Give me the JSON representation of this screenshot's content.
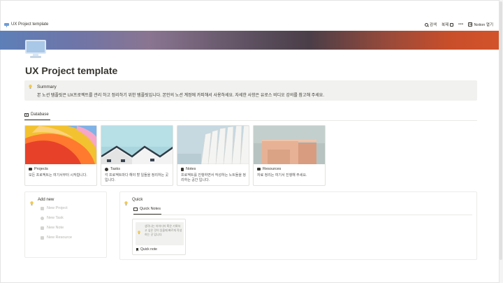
{
  "topbar": {
    "page_name": "UX Project template",
    "search_label": "검색",
    "duplicate_label": "복제",
    "more_label": "•••",
    "open_notion_label": "Notion 열기"
  },
  "page": {
    "title": "UX Project template"
  },
  "summary": {
    "heading": "Summary",
    "body": "본 노션 템플릿은 UX프로젝트를 관리 하고 정리하기 위한 템플릿입니다. 본인의 노션 계정에 카피해서 사용하세요. 자세한 사항은 유로스 비디오 강의를 참고해 주세요."
  },
  "database": {
    "tab_label": "Database",
    "cards": [
      {
        "title": "Projects",
        "description": "모든 프로젝트는 여기서부터 시작합니다."
      },
      {
        "title": "Tasks",
        "description": "각 프로젝트마다 해야 할 일들을 정리하는 곳입니다."
      },
      {
        "title": "Notes",
        "description": "프로젝트를 진행하면서 작성하는 노트들을 정리하는 공간 입니다."
      },
      {
        "title": "Resources",
        "description": "자료 정리는 여기서 진행해 주세요."
      }
    ]
  },
  "add_new": {
    "heading": "Add new",
    "items": [
      "New Project",
      "New Task",
      "New Note",
      "New Resource"
    ]
  },
  "quick": {
    "heading": "Quick",
    "tab_label": "Quick Notes",
    "note_text": "생각나는 아이디어 혹은 기록하고 싶은 것이 있을때 빠르게 작성하는 곳 입니다.",
    "note_title": "Quick note"
  },
  "colors": {
    "accent": "#37352f",
    "callout_bg": "#f1f1ef",
    "muted_text": "#b4b4b0"
  }
}
